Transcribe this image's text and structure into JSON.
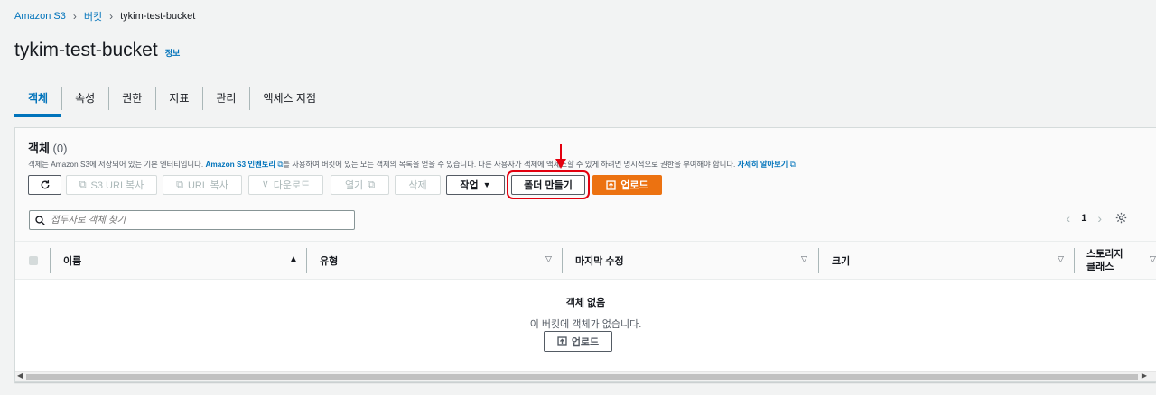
{
  "breadcrumb": {
    "items": [
      "Amazon S3",
      "버킷",
      "tykim-test-bucket"
    ],
    "separator": ">"
  },
  "page": {
    "title": "tykim-test-bucket",
    "info_link": "정보"
  },
  "tabs": [
    {
      "label": "객체",
      "active": true
    },
    {
      "label": "속성",
      "active": false
    },
    {
      "label": "권한",
      "active": false
    },
    {
      "label": "지표",
      "active": false
    },
    {
      "label": "관리",
      "active": false
    },
    {
      "label": "액세스 지점",
      "active": false
    }
  ],
  "objects_panel": {
    "title": "객체",
    "count": "(0)",
    "description_pre": "객체는 Amazon S3에 저장되어 있는 기본 엔터티입니다. ",
    "inventory_link": "Amazon S3 인벤토리",
    "description_mid": "를 사용하여 버킷에 있는 모든 객체의 목록을 얻을 수 있습니다. 다른 사용자가 객체에 액세스할 수 있게 하려면 명시적으로 권한을 부여해야 합니다. ",
    "learn_more_link": "자세히 알아보기",
    "toolbar": {
      "refresh_icon": "refresh-icon",
      "copy_s3_uri": "S3 URI 복사",
      "copy_url": "URL 복사",
      "download": "다운로드",
      "open": "열기",
      "delete": "삭제",
      "actions": "작업",
      "create_folder": "폴더 만들기",
      "upload": "업로드"
    },
    "search": {
      "placeholder": "접두사로 객체 찾기",
      "value": ""
    },
    "pagination": {
      "current_page": "1"
    },
    "table": {
      "columns": [
        "이름",
        "유형",
        "마지막 수정",
        "크기",
        "스토리지 클래스"
      ],
      "sorted_column": "이름",
      "rows": []
    },
    "empty_state": {
      "title": "객체 없음",
      "message": "이 버킷에 객체가 없습니다.",
      "upload_button": "업로드"
    }
  },
  "colors": {
    "link": "#0073bb",
    "primary_button": "#ec7211",
    "highlight_box": "#e3000f",
    "background": "#f2f3f3"
  }
}
